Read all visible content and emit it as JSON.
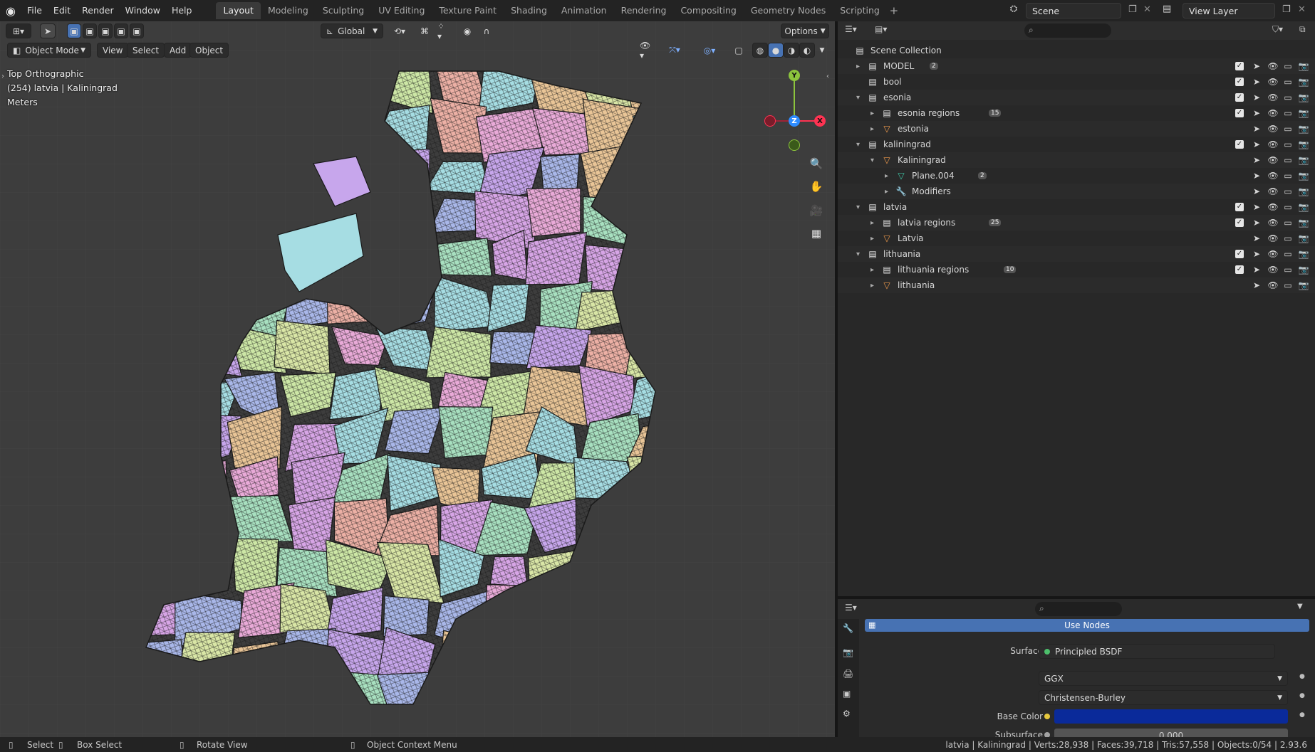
{
  "app": {
    "menu": [
      "File",
      "Edit",
      "Render",
      "Window",
      "Help"
    ],
    "workspaces": [
      "Layout",
      "Modeling",
      "Sculpting",
      "UV Editing",
      "Texture Paint",
      "Shading",
      "Animation",
      "Rendering",
      "Compositing",
      "Geometry Nodes",
      "Scripting"
    ],
    "active_workspace": "Layout",
    "scene_name": "Scene",
    "view_layer": "View Layer"
  },
  "viewport": {
    "orientation": "Global",
    "options_label": "Options",
    "mode": "Object Mode",
    "header_menu": [
      "View",
      "Select",
      "Add",
      "Object"
    ],
    "info_view": "Top Orthographic",
    "info_object": "(254) latvia | Kaliningrad",
    "info_units": "Meters",
    "gizmo_axes": {
      "y": "Y",
      "z": "Z",
      "x": "X"
    },
    "region_colors": [
      "#d7a5e6",
      "#a6dde3",
      "#cde7a6",
      "#a9b7e9",
      "#ecb0a5",
      "#e9c597",
      "#c7a6ec",
      "#a8e0c0",
      "#e9aad8",
      "#d9e6a6"
    ]
  },
  "outliner": {
    "root": "Scene Collection",
    "rows": [
      {
        "name": "MODEL",
        "depth": 0,
        "kind": "collection",
        "expand": "▸",
        "badge": "2",
        "checkbox": true
      },
      {
        "name": "bool",
        "depth": 0,
        "kind": "collection",
        "expand": "",
        "badge": "",
        "checkbox": true
      },
      {
        "name": "esonia",
        "depth": 0,
        "kind": "collection",
        "expand": "▾",
        "badge": "",
        "checkbox": true
      },
      {
        "name": "esonia regions",
        "depth": 1,
        "kind": "collection",
        "expand": "▸",
        "badge": "15",
        "checkbox": true
      },
      {
        "name": "estonia",
        "depth": 1,
        "kind": "mesh",
        "expand": "▸",
        "badge": "",
        "checkbox": false
      },
      {
        "name": "kaliningrad",
        "depth": 0,
        "kind": "collection",
        "expand": "▾",
        "badge": "",
        "checkbox": true
      },
      {
        "name": "Kaliningrad",
        "depth": 1,
        "kind": "mesh",
        "expand": "▾",
        "badge": "",
        "checkbox": false
      },
      {
        "name": "Plane.004",
        "depth": 2,
        "kind": "meshdata",
        "expand": "▸",
        "badge": "2",
        "checkbox": false
      },
      {
        "name": "Modifiers",
        "depth": 2,
        "kind": "modifier",
        "expand": "▸",
        "badge": "",
        "checkbox": false
      },
      {
        "name": "latvia",
        "depth": 0,
        "kind": "collection",
        "expand": "▾",
        "badge": "",
        "checkbox": true
      },
      {
        "name": "latvia regions",
        "depth": 1,
        "kind": "collection",
        "expand": "▸",
        "badge": "25",
        "checkbox": true
      },
      {
        "name": "Latvia",
        "depth": 1,
        "kind": "mesh",
        "expand": "▸",
        "badge": "",
        "checkbox": false
      },
      {
        "name": "lithuania",
        "depth": 0,
        "kind": "collection",
        "expand": "▾",
        "badge": "",
        "checkbox": true
      },
      {
        "name": "lithuania regions",
        "depth": 1,
        "kind": "collection",
        "expand": "▸",
        "badge": "10",
        "checkbox": true
      },
      {
        "name": "lithuania",
        "depth": 1,
        "kind": "mesh",
        "expand": "▸",
        "badge": "",
        "checkbox": false
      }
    ]
  },
  "properties": {
    "use_nodes": "Use Nodes",
    "surface_label": "Surface",
    "surface_value": "Principled BSDF",
    "distribution": "GGX",
    "subsurface_method": "Christensen-Burley",
    "base_color_label": "Base Color",
    "base_color": "#0a2a9a",
    "subsurface_label": "Subsurface",
    "subsurface_value": "0.000"
  },
  "statusbar": {
    "select": "Select",
    "box_select": "Box Select",
    "rotate_view": "Rotate View",
    "context_menu": "Object Context Menu",
    "stats": "latvia | Kaliningrad | Verts:28,938 | Faces:39,718 | Tris:57,558 | Objects:0/54 | 2.93.6"
  }
}
